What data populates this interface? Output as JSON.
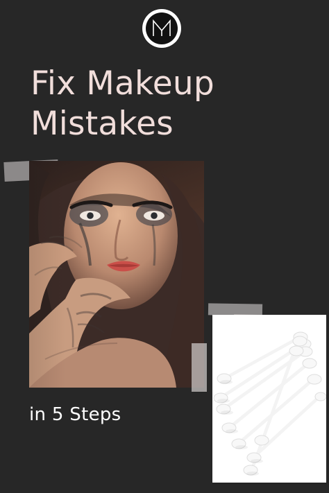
{
  "brand": {
    "logo_monogram": "M",
    "logo_colors": {
      "outer": "#ffffff",
      "inner": "#111111"
    }
  },
  "content": {
    "headline_line_1": "Fix Makeup",
    "headline_line_2": "Mistakes",
    "subheading": "in 5 Steps"
  },
  "visuals": {
    "portrait": "woman with smudged makeup",
    "cotton_swabs": "cotton swabs on white background"
  },
  "colors": {
    "background": "#272727",
    "headline": "#f1dedb",
    "subheading": "#ffffff"
  }
}
